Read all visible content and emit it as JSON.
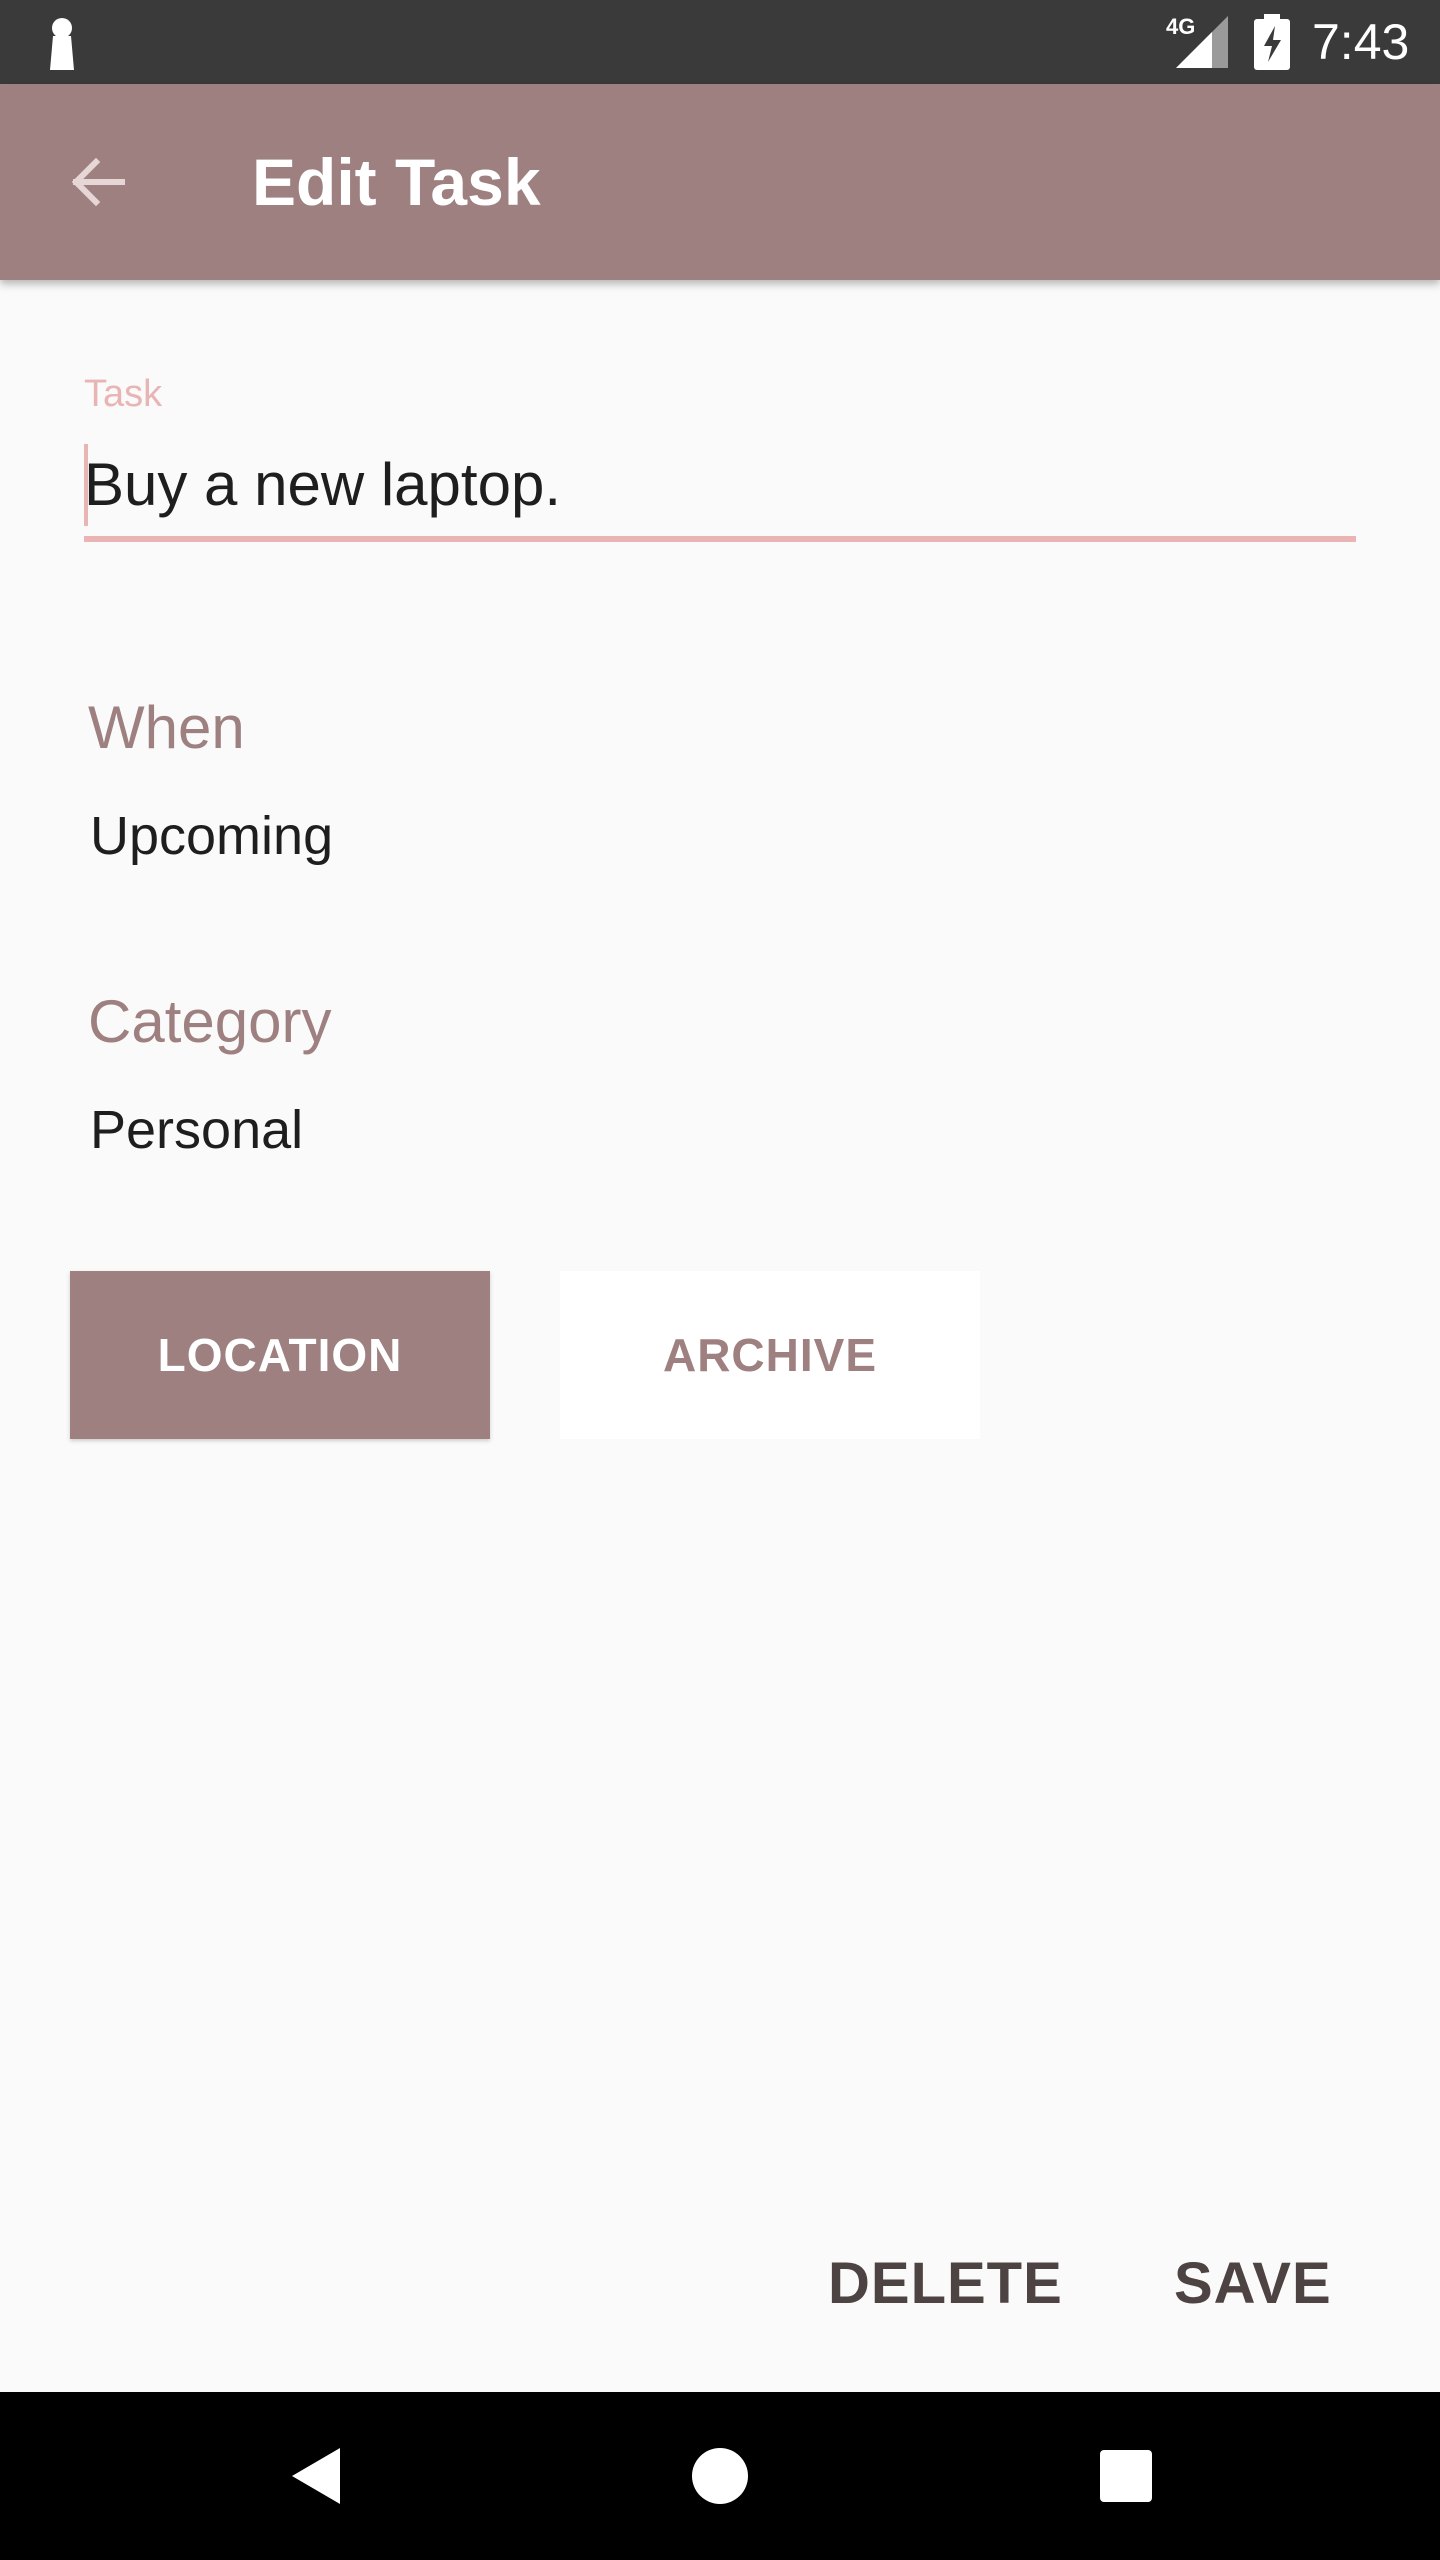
{
  "status_bar": {
    "network": "4G",
    "time": "7:43",
    "icons": [
      "keyhole-icon",
      "signal-icon",
      "battery-charging-icon"
    ]
  },
  "app_bar": {
    "title": "Edit Task",
    "back_icon": "arrow-back-icon"
  },
  "task_field": {
    "label": "Task",
    "value": "Buy a new laptop."
  },
  "when": {
    "label": "When",
    "value": "Upcoming"
  },
  "category": {
    "label": "Category",
    "value": "Personal"
  },
  "buttons": {
    "location": "LOCATION",
    "archive": "ARCHIVE",
    "delete": "DELETE",
    "save": "SAVE"
  },
  "nav_bar": {
    "icons": [
      "back-triangle-icon",
      "home-circle-icon",
      "recents-square-icon"
    ]
  },
  "colors": {
    "primary": "#9e8080",
    "accent": "#e9b4b4",
    "status_bar": "#3a3a3a",
    "background": "#fafafa"
  }
}
